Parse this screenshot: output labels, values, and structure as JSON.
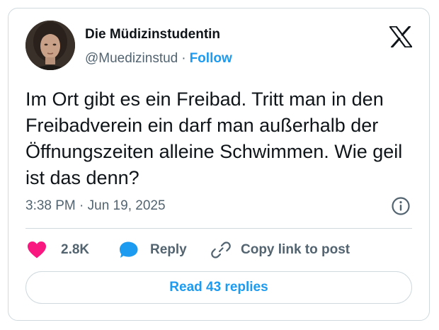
{
  "author": {
    "display_name": "Die Müdizinstudentin",
    "handle": "@Muedizinstud",
    "separator": "·",
    "follow_label": "Follow"
  },
  "tweet": {
    "text": "Im Ort gibt es ein Freibad. Tritt man in den Freibadverein ein darf man außerhalb der Öffnungszeiten alleine Schwimmen. Wie geil ist das denn?",
    "timestamp": "3:38 PM · Jun 19, 2025"
  },
  "actions": {
    "like_count": "2.8K",
    "reply_label": "Reply",
    "copy_link_label": "Copy link to post"
  },
  "footer": {
    "read_replies_label": "Read 43 replies"
  },
  "icons": {
    "brand": "x-logo-icon",
    "info": "info-icon",
    "like": "heart-icon",
    "reply": "speech-bubble-icon",
    "copy": "link-icon"
  },
  "colors": {
    "accent": "#1d9bf0",
    "like": "#f91880",
    "secondary_text": "#536471",
    "border": "#cfd9de",
    "text": "#0f1419"
  }
}
